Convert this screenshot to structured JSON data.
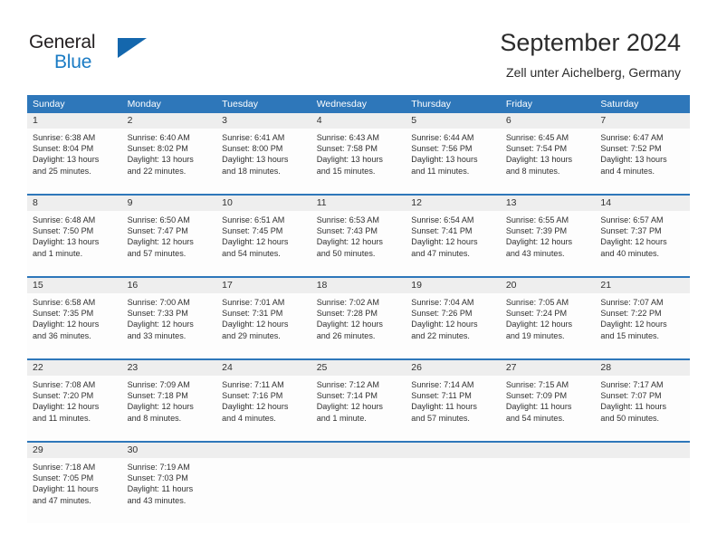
{
  "brand": {
    "name_part1": "General",
    "name_part2": "Blue",
    "logo_icon": "triangle-logo-icon"
  },
  "header": {
    "title": "September 2024",
    "subtitle": "Zell unter Aichelberg, Germany"
  },
  "colors": {
    "header_blue": "#2e77ba",
    "brand_blue": "#1a7bc4",
    "logo_blue": "#1467ad",
    "date_row_gray": "#eeeeee",
    "text": "#313131"
  },
  "weekdays": [
    "Sunday",
    "Monday",
    "Tuesday",
    "Wednesday",
    "Thursday",
    "Friday",
    "Saturday"
  ],
  "weeks": [
    {
      "days": [
        {
          "date": "1",
          "sunrise": "Sunrise: 6:38 AM",
          "sunset": "Sunset: 8:04 PM",
          "daylight_line1": "Daylight: 13 hours",
          "daylight_line2": "and 25 minutes."
        },
        {
          "date": "2",
          "sunrise": "Sunrise: 6:40 AM",
          "sunset": "Sunset: 8:02 PM",
          "daylight_line1": "Daylight: 13 hours",
          "daylight_line2": "and 22 minutes."
        },
        {
          "date": "3",
          "sunrise": "Sunrise: 6:41 AM",
          "sunset": "Sunset: 8:00 PM",
          "daylight_line1": "Daylight: 13 hours",
          "daylight_line2": "and 18 minutes."
        },
        {
          "date": "4",
          "sunrise": "Sunrise: 6:43 AM",
          "sunset": "Sunset: 7:58 PM",
          "daylight_line1": "Daylight: 13 hours",
          "daylight_line2": "and 15 minutes."
        },
        {
          "date": "5",
          "sunrise": "Sunrise: 6:44 AM",
          "sunset": "Sunset: 7:56 PM",
          "daylight_line1": "Daylight: 13 hours",
          "daylight_line2": "and 11 minutes."
        },
        {
          "date": "6",
          "sunrise": "Sunrise: 6:45 AM",
          "sunset": "Sunset: 7:54 PM",
          "daylight_line1": "Daylight: 13 hours",
          "daylight_line2": "and 8 minutes."
        },
        {
          "date": "7",
          "sunrise": "Sunrise: 6:47 AM",
          "sunset": "Sunset: 7:52 PM",
          "daylight_line1": "Daylight: 13 hours",
          "daylight_line2": "and 4 minutes."
        }
      ]
    },
    {
      "days": [
        {
          "date": "8",
          "sunrise": "Sunrise: 6:48 AM",
          "sunset": "Sunset: 7:50 PM",
          "daylight_line1": "Daylight: 13 hours",
          "daylight_line2": "and 1 minute."
        },
        {
          "date": "9",
          "sunrise": "Sunrise: 6:50 AM",
          "sunset": "Sunset: 7:47 PM",
          "daylight_line1": "Daylight: 12 hours",
          "daylight_line2": "and 57 minutes."
        },
        {
          "date": "10",
          "sunrise": "Sunrise: 6:51 AM",
          "sunset": "Sunset: 7:45 PM",
          "daylight_line1": "Daylight: 12 hours",
          "daylight_line2": "and 54 minutes."
        },
        {
          "date": "11",
          "sunrise": "Sunrise: 6:53 AM",
          "sunset": "Sunset: 7:43 PM",
          "daylight_line1": "Daylight: 12 hours",
          "daylight_line2": "and 50 minutes."
        },
        {
          "date": "12",
          "sunrise": "Sunrise: 6:54 AM",
          "sunset": "Sunset: 7:41 PM",
          "daylight_line1": "Daylight: 12 hours",
          "daylight_line2": "and 47 minutes."
        },
        {
          "date": "13",
          "sunrise": "Sunrise: 6:55 AM",
          "sunset": "Sunset: 7:39 PM",
          "daylight_line1": "Daylight: 12 hours",
          "daylight_line2": "and 43 minutes."
        },
        {
          "date": "14",
          "sunrise": "Sunrise: 6:57 AM",
          "sunset": "Sunset: 7:37 PM",
          "daylight_line1": "Daylight: 12 hours",
          "daylight_line2": "and 40 minutes."
        }
      ]
    },
    {
      "days": [
        {
          "date": "15",
          "sunrise": "Sunrise: 6:58 AM",
          "sunset": "Sunset: 7:35 PM",
          "daylight_line1": "Daylight: 12 hours",
          "daylight_line2": "and 36 minutes."
        },
        {
          "date": "16",
          "sunrise": "Sunrise: 7:00 AM",
          "sunset": "Sunset: 7:33 PM",
          "daylight_line1": "Daylight: 12 hours",
          "daylight_line2": "and 33 minutes."
        },
        {
          "date": "17",
          "sunrise": "Sunrise: 7:01 AM",
          "sunset": "Sunset: 7:31 PM",
          "daylight_line1": "Daylight: 12 hours",
          "daylight_line2": "and 29 minutes."
        },
        {
          "date": "18",
          "sunrise": "Sunrise: 7:02 AM",
          "sunset": "Sunset: 7:28 PM",
          "daylight_line1": "Daylight: 12 hours",
          "daylight_line2": "and 26 minutes."
        },
        {
          "date": "19",
          "sunrise": "Sunrise: 7:04 AM",
          "sunset": "Sunset: 7:26 PM",
          "daylight_line1": "Daylight: 12 hours",
          "daylight_line2": "and 22 minutes."
        },
        {
          "date": "20",
          "sunrise": "Sunrise: 7:05 AM",
          "sunset": "Sunset: 7:24 PM",
          "daylight_line1": "Daylight: 12 hours",
          "daylight_line2": "and 19 minutes."
        },
        {
          "date": "21",
          "sunrise": "Sunrise: 7:07 AM",
          "sunset": "Sunset: 7:22 PM",
          "daylight_line1": "Daylight: 12 hours",
          "daylight_line2": "and 15 minutes."
        }
      ]
    },
    {
      "days": [
        {
          "date": "22",
          "sunrise": "Sunrise: 7:08 AM",
          "sunset": "Sunset: 7:20 PM",
          "daylight_line1": "Daylight: 12 hours",
          "daylight_line2": "and 11 minutes."
        },
        {
          "date": "23",
          "sunrise": "Sunrise: 7:09 AM",
          "sunset": "Sunset: 7:18 PM",
          "daylight_line1": "Daylight: 12 hours",
          "daylight_line2": "and 8 minutes."
        },
        {
          "date": "24",
          "sunrise": "Sunrise: 7:11 AM",
          "sunset": "Sunset: 7:16 PM",
          "daylight_line1": "Daylight: 12 hours",
          "daylight_line2": "and 4 minutes."
        },
        {
          "date": "25",
          "sunrise": "Sunrise: 7:12 AM",
          "sunset": "Sunset: 7:14 PM",
          "daylight_line1": "Daylight: 12 hours",
          "daylight_line2": "and 1 minute."
        },
        {
          "date": "26",
          "sunrise": "Sunrise: 7:14 AM",
          "sunset": "Sunset: 7:11 PM",
          "daylight_line1": "Daylight: 11 hours",
          "daylight_line2": "and 57 minutes."
        },
        {
          "date": "27",
          "sunrise": "Sunrise: 7:15 AM",
          "sunset": "Sunset: 7:09 PM",
          "daylight_line1": "Daylight: 11 hours",
          "daylight_line2": "and 54 minutes."
        },
        {
          "date": "28",
          "sunrise": "Sunrise: 7:17 AM",
          "sunset": "Sunset: 7:07 PM",
          "daylight_line1": "Daylight: 11 hours",
          "daylight_line2": "and 50 minutes."
        }
      ]
    },
    {
      "days": [
        {
          "date": "29",
          "sunrise": "Sunrise: 7:18 AM",
          "sunset": "Sunset: 7:05 PM",
          "daylight_line1": "Daylight: 11 hours",
          "daylight_line2": "and 47 minutes."
        },
        {
          "date": "30",
          "sunrise": "Sunrise: 7:19 AM",
          "sunset": "Sunset: 7:03 PM",
          "daylight_line1": "Daylight: 11 hours",
          "daylight_line2": "and 43 minutes."
        },
        {
          "date": "",
          "sunrise": "",
          "sunset": "",
          "daylight_line1": "",
          "daylight_line2": ""
        },
        {
          "date": "",
          "sunrise": "",
          "sunset": "",
          "daylight_line1": "",
          "daylight_line2": ""
        },
        {
          "date": "",
          "sunrise": "",
          "sunset": "",
          "daylight_line1": "",
          "daylight_line2": ""
        },
        {
          "date": "",
          "sunrise": "",
          "sunset": "",
          "daylight_line1": "",
          "daylight_line2": ""
        },
        {
          "date": "",
          "sunrise": "",
          "sunset": "",
          "daylight_line1": "",
          "daylight_line2": ""
        }
      ]
    }
  ]
}
